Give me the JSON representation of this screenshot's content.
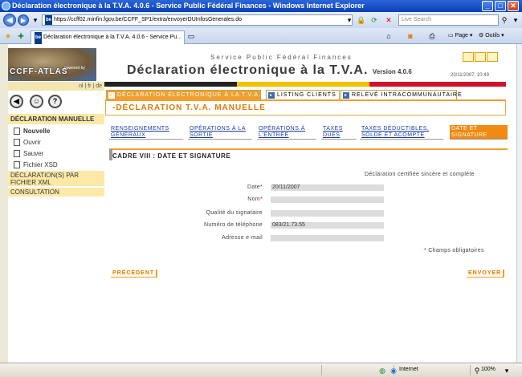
{
  "window": {
    "title": "Déclaration électronique à la T.V.A. 4.0.6 - Service Public Fédéral Finances - Windows Internet Explorer"
  },
  "browser": {
    "url": "https://ccff02.minfin.fgov.be/CCFF_SP1/extra/envoyerDUInfosGenerales.do",
    "url_favicon": "be",
    "search_placeholder": "Live Search",
    "tab_label": "Déclaration électronique à la T.V.A. 4.0.6 - Service Pu...",
    "page_menu": "Page",
    "tools_menu": "Outils",
    "status_zone": "Internet",
    "zoom": "100%"
  },
  "header": {
    "logo_text": "CCFF-ATLAS",
    "logo_small": "powered by",
    "service": "Service Public Fédéral Finances",
    "title": "Déclaration électronique à la T.V.A.",
    "version": "Version 4.0.6",
    "datetime": "20/11/2007, 10:49",
    "lang": "nl | fr | de"
  },
  "sidebar": {
    "heading": "DÉCLARATION MANUELLE",
    "items": [
      {
        "label": "Nouvelle"
      },
      {
        "label": "Ouvrir"
      },
      {
        "label": "Sauver"
      },
      {
        "label": "Fichier XSD"
      }
    ],
    "section_xml": "DÉCLARATION(S) PAR FICHIER XML",
    "section_consult": "CONSULTATION"
  },
  "main_tabs": [
    {
      "label": "DÉCLARATION ÉLECTRONIQUE À LA T.V.A."
    },
    {
      "label": "LISTING CLIENTS"
    },
    {
      "label": "RELEVÉ INTRACOMMUNAUTAIRE"
    }
  ],
  "form": {
    "title": "-DÉCLARATION T.V.A. MANUELLE",
    "steps": [
      {
        "line1": "RENSEIGNEMENTS",
        "line2": "GÉNÉRAUX"
      },
      {
        "line1": "OPÉRATIONS À LA",
        "line2": "SORTIE"
      },
      {
        "line1": "OPÉRATIONS À",
        "line2": "L'ENTRÉE"
      },
      {
        "line1": "TAXES",
        "line2": "DUES"
      },
      {
        "line1": "TAXES DÉDUCTIBLES,",
        "line2": "SOLDE ET ACOMPTE"
      },
      {
        "line1": "DATE ET",
        "line2": "SIGNATURE"
      }
    ],
    "cadre_title": "CADRE VIII : DATE ET SIGNATURE",
    "certification": "Déclaration certifiée sincère et complète",
    "fields": {
      "date_label": "Date",
      "date_value": "20/11/2007",
      "nom_label": "Nom",
      "nom_value": "",
      "qualite_label": "Qualité du signataire",
      "qualite_value": "",
      "tel_label": "Numéro de téléphone",
      "tel_value": "083/21.73.55",
      "email_label": "Adresse e-mail",
      "email_value": ""
    },
    "required_mark": "*",
    "required_note": "Champs obligatoires",
    "prev_button": "PRÉCÉDENT",
    "send_button": "ENVOYER"
  },
  "colors": {
    "accent": "#f0a030",
    "link": "#1a3ca0",
    "required": "#d01010",
    "titlebar": "#0a3fb5"
  }
}
